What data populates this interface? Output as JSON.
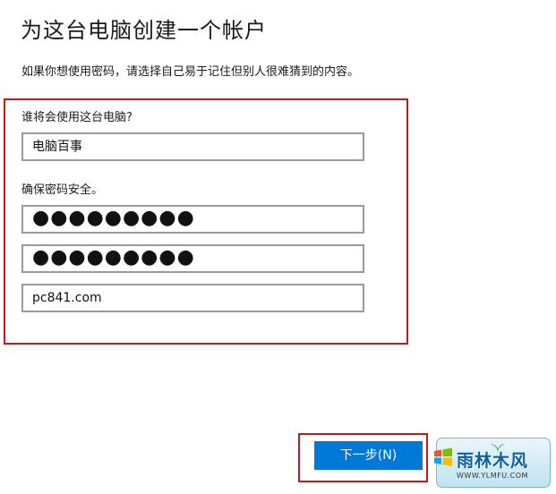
{
  "page": {
    "title": "为这台电脑创建一个帐户",
    "subtitle": "如果你想使用密码，请选择自己易于记住但别人很难猜到的内容。"
  },
  "form": {
    "username_label": "谁将会使用这台电脑?",
    "username_value": "电脑百事",
    "password_label": "确保密码安全。",
    "password_mask": "●●●●●●●●●",
    "confirm_mask": "●●●●●●●●●",
    "hint_value": "pc841.com"
  },
  "footer": {
    "next_label": "下一步(N)"
  },
  "watermark": {
    "name": "雨林木风",
    "url": "WWW.YLMFU.COM"
  },
  "colors": {
    "accent": "#0078d7",
    "highlight": "#c8161d",
    "field_border": "#9a9a9a"
  }
}
